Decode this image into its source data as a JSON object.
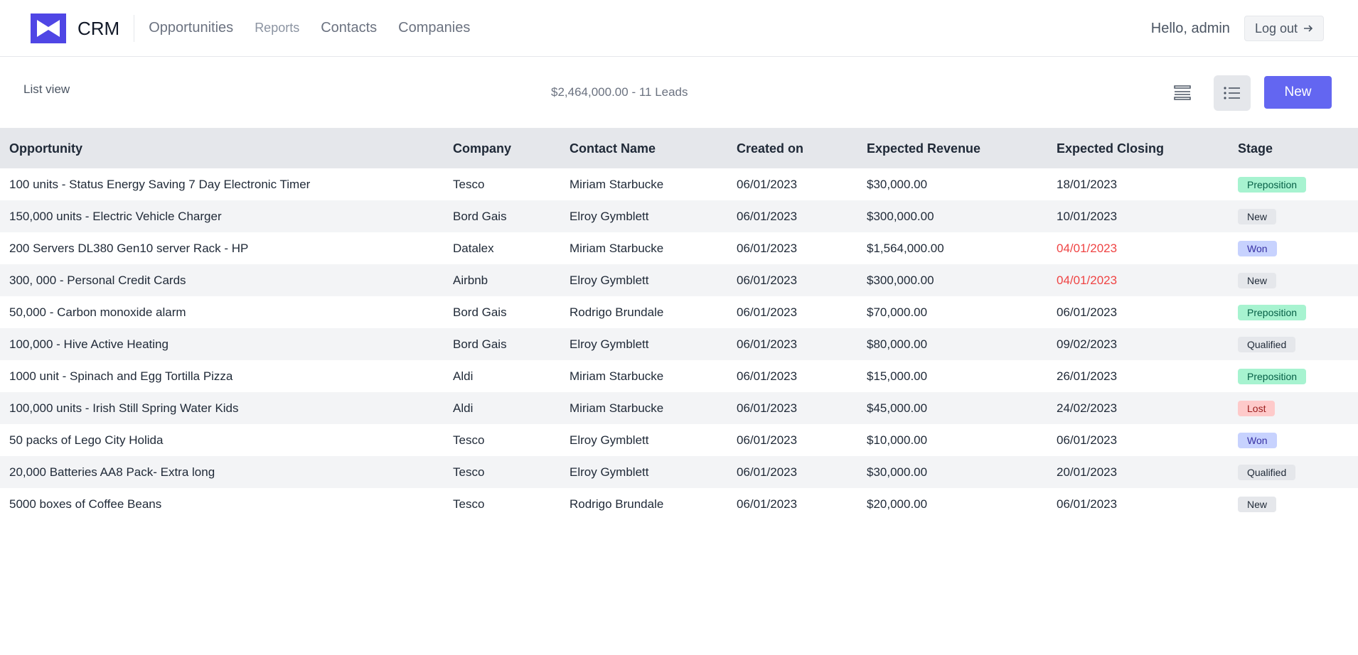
{
  "app": {
    "brand": "CRM",
    "nav": [
      "Opportunities",
      "Reports",
      "Contacts",
      "Companies"
    ],
    "greeting": "Hello, admin",
    "logout_label": "Log out"
  },
  "toolbar": {
    "view_label": "List view",
    "summary": "$2,464,000.00 - 11 Leads",
    "new_label": "New",
    "active_view": "list"
  },
  "table": {
    "columns": [
      "Opportunity",
      "Company",
      "Contact Name",
      "Created on",
      "Expected Revenue",
      "Expected Closing",
      "Stage"
    ],
    "rows": [
      {
        "opportunity": "100 units - Status Energy Saving 7 Day Electronic Timer",
        "company": "Tesco",
        "contact": "Miriam Starbucke",
        "created": "06/01/2023",
        "revenue": "$30,000.00",
        "closing": "18/01/2023",
        "closing_overdue": false,
        "stage": "Preposition"
      },
      {
        "opportunity": "150,000 units - Electric Vehicle Charger",
        "company": "Bord Gais",
        "contact": "Elroy Gymblett",
        "created": "06/01/2023",
        "revenue": "$300,000.00",
        "closing": "10/01/2023",
        "closing_overdue": false,
        "stage": "New"
      },
      {
        "opportunity": "200 Servers DL380 Gen10 server Rack - HP",
        "company": "Datalex",
        "contact": "Miriam Starbucke",
        "created": "06/01/2023",
        "revenue": "$1,564,000.00",
        "closing": "04/01/2023",
        "closing_overdue": true,
        "stage": "Won"
      },
      {
        "opportunity": "300, 000 - Personal Credit Cards",
        "company": "Airbnb",
        "contact": "Elroy Gymblett",
        "created": "06/01/2023",
        "revenue": "$300,000.00",
        "closing": "04/01/2023",
        "closing_overdue": true,
        "stage": "New"
      },
      {
        "opportunity": "50,000 - Carbon monoxide alarm",
        "company": "Bord Gais",
        "contact": "Rodrigo Brundale",
        "created": "06/01/2023",
        "revenue": "$70,000.00",
        "closing": "06/01/2023",
        "closing_overdue": false,
        "stage": "Preposition"
      },
      {
        "opportunity": "100,000 - Hive Active Heating",
        "company": "Bord Gais",
        "contact": "Elroy Gymblett",
        "created": "06/01/2023",
        "revenue": "$80,000.00",
        "closing": "09/02/2023",
        "closing_overdue": false,
        "stage": "Qualified"
      },
      {
        "opportunity": "1000 unit - Spinach and Egg Tortilla Pizza",
        "company": "Aldi",
        "contact": "Miriam Starbucke",
        "created": "06/01/2023",
        "revenue": "$15,000.00",
        "closing": "26/01/2023",
        "closing_overdue": false,
        "stage": "Preposition"
      },
      {
        "opportunity": "100,000 units - Irish Still Spring Water Kids",
        "company": "Aldi",
        "contact": "Miriam Starbucke",
        "created": "06/01/2023",
        "revenue": "$45,000.00",
        "closing": "24/02/2023",
        "closing_overdue": false,
        "stage": "Lost"
      },
      {
        "opportunity": "50 packs of Lego City Holida",
        "company": "Tesco",
        "contact": "Elroy Gymblett",
        "created": "06/01/2023",
        "revenue": "$10,000.00",
        "closing": "06/01/2023",
        "closing_overdue": false,
        "stage": "Won"
      },
      {
        "opportunity": "20,000 Batteries AA8 Pack- Extra long",
        "company": "Tesco",
        "contact": "Elroy Gymblett",
        "created": "06/01/2023",
        "revenue": "$30,000.00",
        "closing": "20/01/2023",
        "closing_overdue": false,
        "stage": "Qualified"
      },
      {
        "opportunity": "5000 boxes of Coffee Beans",
        "company": "Tesco",
        "contact": "Rodrigo Brundale",
        "created": "06/01/2023",
        "revenue": "$20,000.00",
        "closing": "06/01/2023",
        "closing_overdue": false,
        "stage": "New"
      }
    ]
  },
  "colors": {
    "accent": "#6366f1",
    "logo": "#4f46e5",
    "overdue": "#ef4444"
  }
}
